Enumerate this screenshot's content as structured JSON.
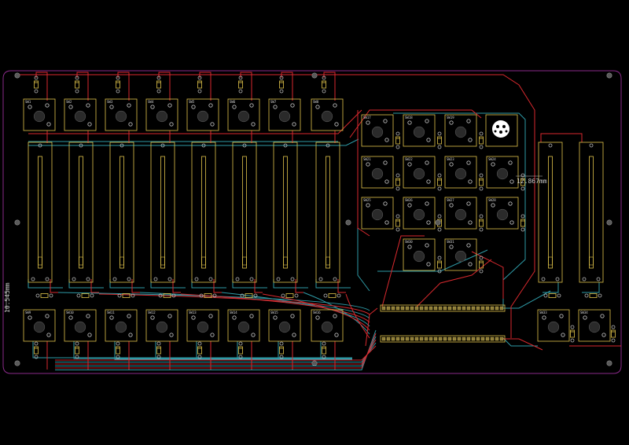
{
  "layers": {
    "outline_color": "#8a2a8a",
    "silk_color": "#e0c44a",
    "front_copper_color": "#d8292e",
    "back_copper_color": "#2e9aa6",
    "pad_color": "#b8b8b8",
    "background_color": "#000000"
  },
  "dimensions": {
    "left_label": "10.545mm",
    "right_label": "12.867mm"
  },
  "fader_block": {
    "channel_count": 8,
    "component_refs_top": [
      "SW1",
      "SW2",
      "SW3",
      "SW4",
      "SW5",
      "SW6",
      "SW7",
      "SW8"
    ],
    "component_refs_bottom": [
      "SW9",
      "SW10",
      "SW11",
      "SW12",
      "SW13",
      "SW14",
      "SW15",
      "SW16"
    ]
  },
  "button_grid": {
    "rows": 4,
    "cols": 4,
    "component_refs": [
      "SW17",
      "SW18",
      "SW19",
      "SW20",
      "SW21",
      "SW22",
      "SW23",
      "SW24",
      "SW25",
      "SW26",
      "SW27",
      "SW28",
      "SW29",
      "SW30",
      "SW31",
      "SW32"
    ]
  },
  "right_faders": {
    "count": 2
  },
  "right_buttons": {
    "component_refs": [
      "SW33",
      "SW34"
    ]
  },
  "icons": {
    "mounting_hole": "mounting-hole-icon",
    "logo": "logo-footprint-icon"
  }
}
